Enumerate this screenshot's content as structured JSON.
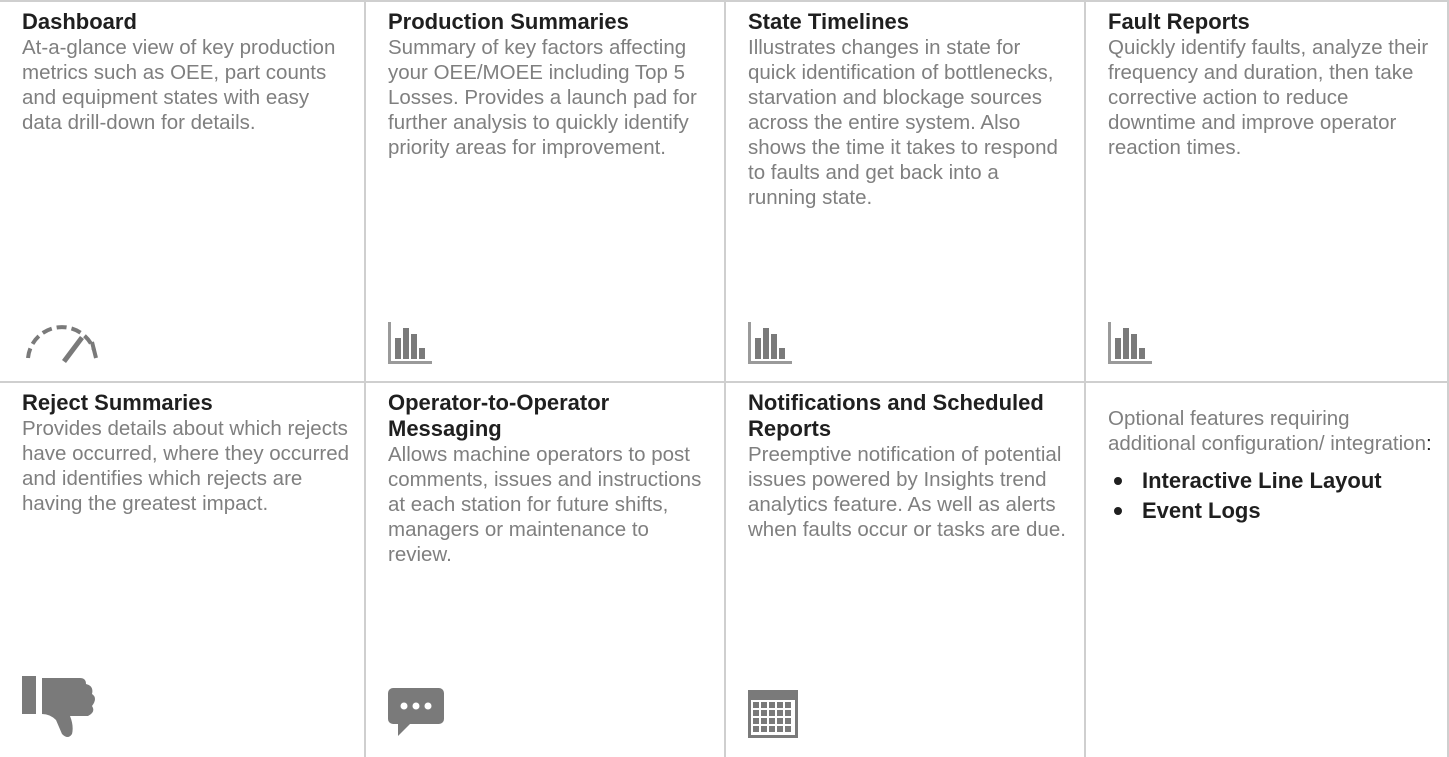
{
  "cards": [
    {
      "title": "Dashboard",
      "desc": "At-a-glance view of key production metrics such as OEE, part counts and equipment states with easy data drill-down for details.",
      "icon": "speedometer-icon"
    },
    {
      "title": "Production Summaries",
      "desc": "Summary of key factors affecting your OEE/MOEE including Top 5 Losses. Provides a launch pad for further analysis to quickly identify priority areas for improvement.",
      "icon": "bar-chart-icon"
    },
    {
      "title": "State Timelines",
      "desc": "Illustrates changes in state for quick identification of bottlenecks, starvation and blockage sources across the entire system.  Also shows the time it takes to respond to faults and get back into a running state.",
      "icon": "bar-chart-icon"
    },
    {
      "title": "Fault Reports",
      "desc": "Quickly identify faults, analyze their frequency and duration, then take corrective action to reduce downtime and improve operator reaction times.",
      "icon": "bar-chart-icon"
    },
    {
      "title": "Reject Summaries",
      "desc": "Provides details about which rejects have occurred, where they occurred and identifies which rejects are having the greatest impact.",
      "icon": "thumbs-down-icon"
    },
    {
      "title": "Operator-to-Operator Messaging",
      "desc": "Allows machine operators to post comments, issues and instructions at each station for future shifts, managers or maintenance to review.",
      "icon": "chat-bubble-icon"
    },
    {
      "title": "Notifications and Scheduled Reports",
      "desc": "Preemptive notification of potential issues powered by Insights trend analytics feature. As well as alerts when faults occur or tasks are due.",
      "icon": "calendar-icon"
    }
  ],
  "optional": {
    "text": "Optional features requiring additional configuration/ integration",
    "colon": ":",
    "features": [
      "Interactive Line Layout",
      "Event Logs"
    ]
  },
  "colors": {
    "icon_gray": "#7a7a7a",
    "title": "#1f1f1f",
    "text_gray": "#7f7f7f",
    "divider": "#cfcfcf"
  }
}
